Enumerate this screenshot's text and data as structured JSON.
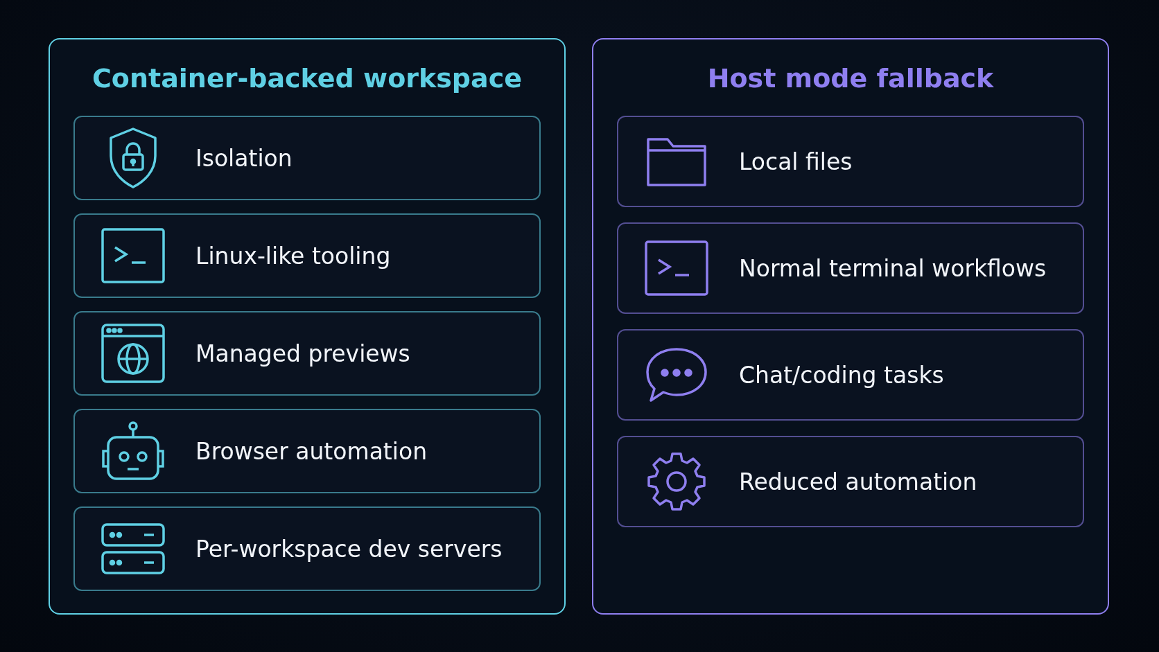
{
  "panels": [
    {
      "title": "Container-backed workspace",
      "color": "#5fd0e4",
      "items": [
        {
          "label": "Isolation"
        },
        {
          "label": "Linux-like tooling"
        },
        {
          "label": "Managed previews"
        },
        {
          "label": "Browser automation"
        },
        {
          "label": "Per-workspace dev servers"
        }
      ]
    },
    {
      "title": "Host mode fallback",
      "color": "#8f7ff0",
      "items": [
        {
          "label": "Local files"
        },
        {
          "label": "Normal terminal workflows"
        },
        {
          "label": "Chat/coding tasks"
        },
        {
          "label": "Reduced automation"
        }
      ]
    }
  ]
}
